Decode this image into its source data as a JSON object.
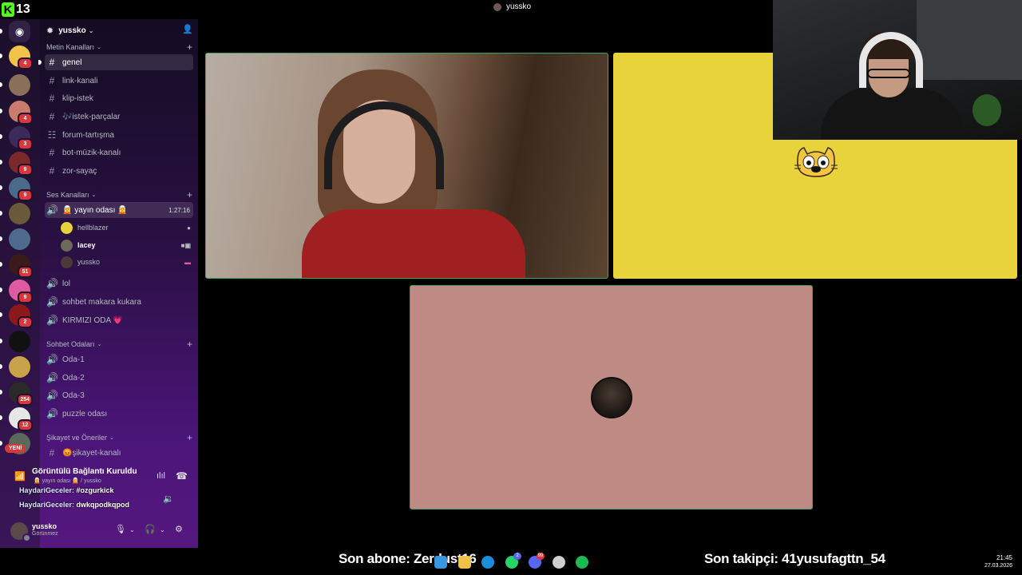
{
  "overlay": {
    "brand_number": "13",
    "brand_letter": "K",
    "call_title": "yussko"
  },
  "server_rail": {
    "items": [
      {
        "name": "discord-home",
        "badge": "",
        "color": "#2f2246"
      },
      {
        "name": "server-jake",
        "badge": "4",
        "color": "#f2c34b"
      },
      {
        "name": "server-2",
        "badge": "",
        "color": "#8a6f5a"
      },
      {
        "name": "server-3",
        "badge": "4",
        "color": "#c97b6c"
      },
      {
        "name": "server-sbins",
        "badge": "3",
        "color": "#3b2a5a"
      },
      {
        "name": "server-5",
        "badge": "9",
        "color": "#7a2a2a"
      },
      {
        "name": "server-6",
        "badge": "9",
        "color": "#4a6a8a"
      },
      {
        "name": "server-7",
        "badge": "",
        "color": "#6a5a3a"
      },
      {
        "name": "server-8",
        "badge": "",
        "color": "#4f6a8f"
      },
      {
        "name": "server-9",
        "badge": "51",
        "color": "#3a1a1a"
      },
      {
        "name": "server-10",
        "badge": "9",
        "color": "#e05aa0"
      },
      {
        "name": "server-11",
        "badge": "2",
        "color": "#8a1a1a"
      },
      {
        "name": "server-kick",
        "badge": "",
        "color": "#111111"
      },
      {
        "name": "server-13",
        "badge": "",
        "color": "#c9a34a"
      },
      {
        "name": "server-14",
        "badge": "254",
        "color": "#2a2a2a"
      },
      {
        "name": "server-15",
        "badge": "12",
        "color": "#e6e6e6"
      },
      {
        "name": "server-16",
        "badge": "",
        "color": "#5a6a5a"
      }
    ],
    "new_label": "YENİ"
  },
  "sidebar": {
    "server_name": "yussko",
    "categories": {
      "text": "Metin Kanalları",
      "voice": "Ses Kanalları",
      "chat": "Sohbet Odaları",
      "complaints": "Şikayet ve Öneriler"
    },
    "text_channels": [
      {
        "name": "genel",
        "icon": "#",
        "unread": true
      },
      {
        "name": "link-kanali",
        "icon": "#"
      },
      {
        "name": "klip-istek",
        "icon": "#"
      },
      {
        "name": "🎶istek-parçalar",
        "icon": "#"
      },
      {
        "name": "forum-tartışma",
        "icon": "💬"
      },
      {
        "name": "bot-müzik-kanalı",
        "icon": "#"
      },
      {
        "name": "zor-sayaç",
        "icon": "#"
      }
    ],
    "voice_active": {
      "name": "🧝 yayın odası 🧝",
      "timer": "1:27:16"
    },
    "voice_users": [
      {
        "name": "hellblazer",
        "color": "#e8d33a"
      },
      {
        "name": "lacey",
        "color": "#6a6a5a",
        "live": true
      },
      {
        "name": "yussko",
        "color": "#4a3a3a"
      }
    ],
    "voice_channels": [
      "lol",
      "sohbet makara kukara",
      "KIRMIZI ODA 💗"
    ],
    "chat_rooms": [
      "Oda-1",
      "Oda-2",
      "Oda-3",
      "puzzle odası"
    ],
    "complaint_channel": "😡şikayet-kanalı"
  },
  "voice_panel": {
    "status": "Görüntülü Bağlantı Kuruldu",
    "subtitle": "🧝 yayın odası 🧝 / yussko",
    "chat": [
      {
        "user": "HaydariGeceler",
        "message": ": #ozgurkick"
      },
      {
        "user": "HaydariGeceler",
        "message": ": dwkqpodkqpod"
      }
    ]
  },
  "user_panel": {
    "name": "yussko",
    "status": "Görünmez"
  },
  "stream_bar": {
    "last_sub": "Son abone: Zerdust16",
    "last_follower": "Son takipçi: 41yusufagttn_54",
    "taskbar_icons": [
      {
        "name": "windows-icon",
        "color": "#3a96dd"
      },
      {
        "name": "explorer-icon",
        "color": "#f2c14b"
      },
      {
        "name": "edge-icon",
        "color": "#1a8fd8"
      },
      {
        "name": "whatsapp-icon",
        "color": "#25d366",
        "badge": "2"
      },
      {
        "name": "discord-icon",
        "color": "#5865f2",
        "badge": "99"
      },
      {
        "name": "steam-icon",
        "color": "#cfcfcf"
      },
      {
        "name": "spotify-icon",
        "color": "#1db954"
      }
    ],
    "time": "21:45",
    "date": "27.03.2026"
  }
}
